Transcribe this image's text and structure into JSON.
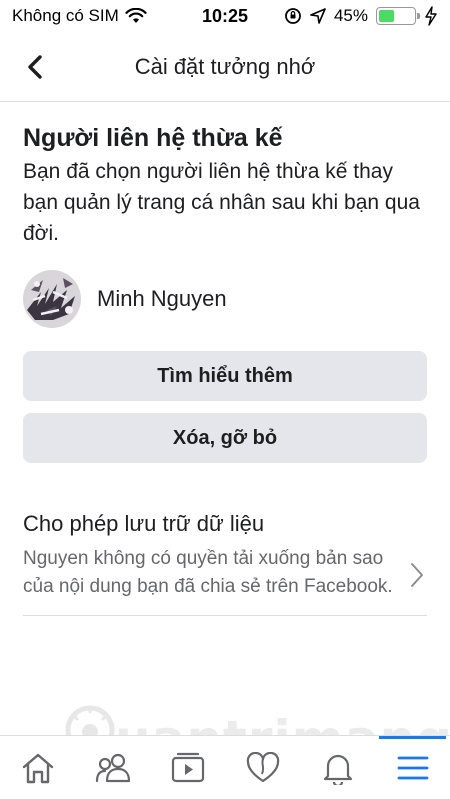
{
  "status_bar": {
    "carrier": "Không có SIM",
    "time": "10:25",
    "battery": "45%",
    "battery_level": 0.45
  },
  "nav": {
    "title": "Cài đặt tưởng nhớ"
  },
  "legacy_contact": {
    "title": "Người liên hệ thừa kế",
    "description": "Bạn đã chọn người liên hệ thừa kế thay bạn quản lý trang cá nhân sau khi bạn qua đời.",
    "contact_name": "Minh Nguyen",
    "learn_more_label": "Tìm hiểu thêm",
    "remove_label": "Xóa, gỡ bỏ"
  },
  "data_permission": {
    "title": "Cho phép lưu trữ dữ liệu",
    "description": "Nguyen không có quyền tải xuống bản sao của nội dung bạn đã chia sẻ trên Facebook."
  },
  "watermark": {
    "text": "uantrimang"
  },
  "tab_bar": {
    "tabs": [
      "home-icon",
      "friends-icon",
      "watch-icon",
      "dating-icon",
      "notifications-icon",
      "menu-icon"
    ],
    "active": "menu-icon"
  },
  "colors": {
    "accent": "#1877f2",
    "button_bg": "#e4e6eb",
    "battery": "#4cd964"
  }
}
